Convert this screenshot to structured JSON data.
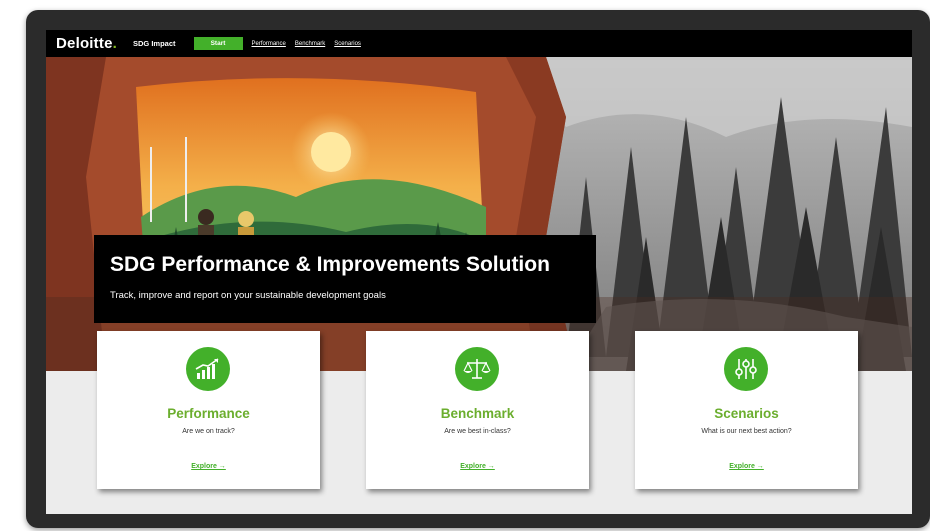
{
  "nav": {
    "logo": "Deloitte",
    "logo_dot": ".",
    "app_name": "SDG Impact",
    "start_label": "Start",
    "links": [
      "Performance",
      "Benchmark",
      "Scenarios"
    ]
  },
  "hero": {
    "title": "SDG Performance & Improvements Solution",
    "subtitle": "Track, improve and report on your sustainable development goals"
  },
  "cards": [
    {
      "title": "Performance",
      "subtitle": "Are we on track?",
      "link": "Explore →",
      "icon": "growth-chart-icon"
    },
    {
      "title": "Benchmark",
      "subtitle": "Are we best in-class?",
      "link": "Explore →",
      "icon": "balance-scale-icon"
    },
    {
      "title": "Scenarios",
      "subtitle": "What is our next best action?",
      "link": "Explore →",
      "icon": "sliders-icon"
    }
  ],
  "colors": {
    "brand_green": "#43b02a",
    "title_green": "#6bae2e",
    "nav_bg": "#000000"
  }
}
